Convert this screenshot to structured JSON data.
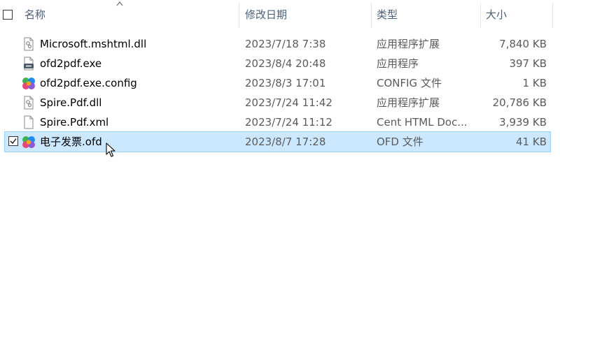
{
  "header": {
    "name": "名称",
    "date": "修改日期",
    "type": "类型",
    "size": "大小"
  },
  "files": [
    {
      "name": "Microsoft.mshtml.dll",
      "date": "2023/7/18 7:38",
      "type": "应用程序扩展",
      "size": "7,840 KB",
      "icon": "dll-icon"
    },
    {
      "name": "ofd2pdf.exe",
      "date": "2023/8/4 20:48",
      "type": "应用程序",
      "size": "397 KB",
      "icon": "exe-icon"
    },
    {
      "name": "ofd2pdf.exe.config",
      "date": "2023/8/3 17:01",
      "type": "CONFIG 文件",
      "size": "1 KB",
      "icon": "ofd-app-icon"
    },
    {
      "name": "Spire.Pdf.dll",
      "date": "2023/7/24 11:42",
      "type": "应用程序扩展",
      "size": "20,786 KB",
      "icon": "dll-icon"
    },
    {
      "name": "Spire.Pdf.xml",
      "date": "2023/7/24 11:12",
      "type": "Cent HTML Doc...",
      "size": "3,939 KB",
      "icon": "blank-file-icon"
    },
    {
      "name": "电子发票.ofd",
      "date": "2023/8/7 17:28",
      "type": "OFD 文件",
      "size": "41 KB",
      "icon": "ofd-app-icon",
      "selected": true
    }
  ],
  "colors": {
    "header_text": "#4c607a",
    "selection_bg": "#cce8ff",
    "selection_border": "#99d1ff",
    "logo_green": "#3fb34f",
    "logo_blue": "#1f8cf0",
    "logo_pink": "#e8457a",
    "logo_purple": "#8e5ad8",
    "logo_orange": "#f4a31b"
  }
}
